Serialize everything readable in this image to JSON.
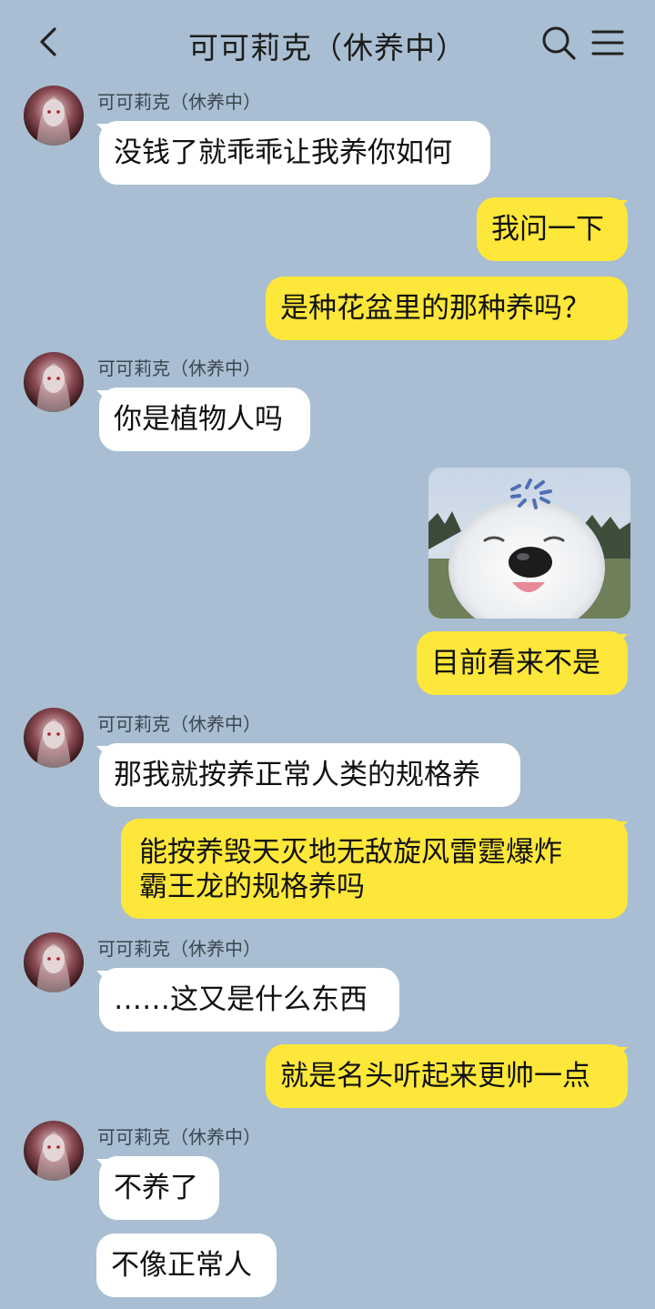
{
  "header": {
    "title": "可可莉克（休养中）",
    "back_icon": "chevron-left-icon",
    "search_icon": "search-icon",
    "menu_icon": "hamburger-menu-icon"
  },
  "colors": {
    "background": "#a9bed2",
    "incoming_bubble": "#ffffff",
    "outgoing_bubble": "#fde73a"
  },
  "messages": [
    {
      "sender": "可可莉克（休养中）",
      "text": "没钱了就乖乖让我养你如何",
      "side": "left"
    },
    {
      "text": "我问一下",
      "side": "right"
    },
    {
      "text": "是种花盆里的那种养吗？",
      "side": "right"
    },
    {
      "sender": "可可莉克（休养中）",
      "text": "你是植物人吗",
      "side": "left"
    },
    {
      "type": "image",
      "description": "smiling white dog sticker",
      "side": "right"
    },
    {
      "text": "目前看来不是",
      "side": "right"
    },
    {
      "sender": "可可莉克（休养中）",
      "text": "那我就按养正常人类的规格养",
      "side": "left"
    },
    {
      "text_line1": "能按养毁天灭地无敌旋风雷霆爆炸",
      "text_line2": "霸王龙的规格养吗",
      "side": "right"
    },
    {
      "sender": "可可莉克（休养中）",
      "text": "……这又是什么东西",
      "side": "left"
    },
    {
      "text": "就是名头听起来更帅一点",
      "side": "right"
    },
    {
      "sender": "可可莉克（休养中）",
      "text": "不养了",
      "side": "left"
    },
    {
      "text": "不像正常人",
      "side": "left"
    }
  ]
}
